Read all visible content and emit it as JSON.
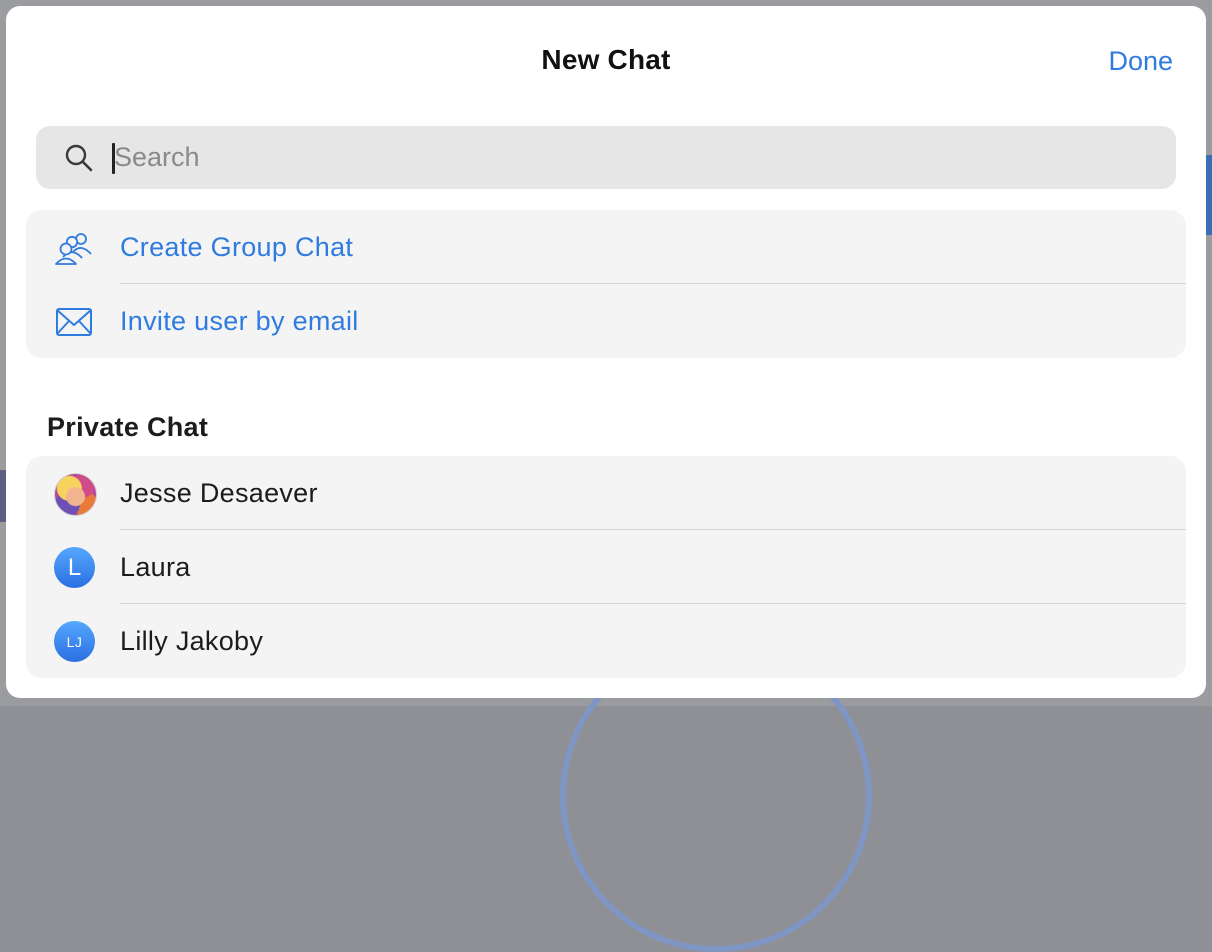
{
  "modal": {
    "title": "New Chat",
    "done_label": "Done"
  },
  "search": {
    "placeholder": "Search",
    "value": ""
  },
  "actions": [
    {
      "label": "Create Group Chat",
      "icon": "group-icon"
    },
    {
      "label": "Invite user by email",
      "icon": "envelope-icon"
    }
  ],
  "private_chat": {
    "heading": "Private Chat",
    "contacts": [
      {
        "name": "Jesse Desaever",
        "avatar": "photo"
      },
      {
        "name": "Laura",
        "initials": "L"
      },
      {
        "name": "Lilly Jakoby",
        "initials": "LJ"
      }
    ]
  },
  "colors": {
    "accent": "#2f7be0",
    "list_background": "#f4f4f5",
    "search_background": "#e6e6e6",
    "avatar_gradient_top": "#56a7ff",
    "avatar_gradient_bottom": "#2a6fe0"
  }
}
